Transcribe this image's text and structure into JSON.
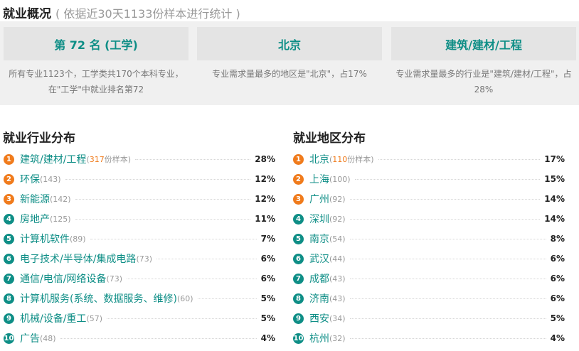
{
  "overview": {
    "title": "就业概况",
    "subtitle": "( 依据近30天1133份样本进行统计 )"
  },
  "summary_cards": [
    {
      "head": "第 72 名 (工学)",
      "desc": "所有专业1123个，工学类共170个本科专业，在\"工学\"中就业排名第72"
    },
    {
      "head": "北京",
      "desc": "专业需求量最多的地区是\"北京\"，占17%"
    },
    {
      "head": "建筑/建材/工程",
      "desc": "专业需求量最多的行业是\"建筑/建材/工程\"，占28%"
    }
  ],
  "industry": {
    "title": "就业行业分布",
    "sample_suffix": "份样本",
    "items": [
      {
        "rank": "1",
        "name": "建筑/建材/工程",
        "count": "317",
        "pct": "28%"
      },
      {
        "rank": "2",
        "name": "环保",
        "count": "(143)",
        "pct": "12%"
      },
      {
        "rank": "3",
        "name": "新能源",
        "count": "(142)",
        "pct": "12%"
      },
      {
        "rank": "4",
        "name": "房地产",
        "count": "(125)",
        "pct": "11%"
      },
      {
        "rank": "5",
        "name": "计算机软件",
        "count": "(89)",
        "pct": "7%"
      },
      {
        "rank": "6",
        "name": "电子技术/半导体/集成电路",
        "count": "(73)",
        "pct": "6%"
      },
      {
        "rank": "7",
        "name": "通信/电信/网络设备",
        "count": "(73)",
        "pct": "6%"
      },
      {
        "rank": "8",
        "name": "计算机服务(系统、数据服务、维修)",
        "count": "(60)",
        "pct": "5%"
      },
      {
        "rank": "9",
        "name": "机械/设备/重工",
        "count": "(57)",
        "pct": "5%"
      },
      {
        "rank": "10",
        "name": "广告",
        "count": "(48)",
        "pct": "4%"
      }
    ]
  },
  "region": {
    "title": "就业地区分布",
    "sample_suffix": "份样本",
    "items": [
      {
        "rank": "1",
        "name": "北京",
        "count": "110",
        "pct": "17%"
      },
      {
        "rank": "2",
        "name": "上海",
        "count": "(100)",
        "pct": "15%"
      },
      {
        "rank": "3",
        "name": "广州",
        "count": "(92)",
        "pct": "14%"
      },
      {
        "rank": "4",
        "name": "深圳",
        "count": "(92)",
        "pct": "14%"
      },
      {
        "rank": "5",
        "name": "南京",
        "count": "(54)",
        "pct": "8%"
      },
      {
        "rank": "6",
        "name": "武汉",
        "count": "(44)",
        "pct": "6%"
      },
      {
        "rank": "7",
        "name": "成都",
        "count": "(43)",
        "pct": "6%"
      },
      {
        "rank": "8",
        "name": "济南",
        "count": "(43)",
        "pct": "6%"
      },
      {
        "rank": "9",
        "name": "西安",
        "count": "(34)",
        "pct": "5%"
      },
      {
        "rank": "10",
        "name": "杭州",
        "count": "(32)",
        "pct": "4%"
      }
    ]
  }
}
